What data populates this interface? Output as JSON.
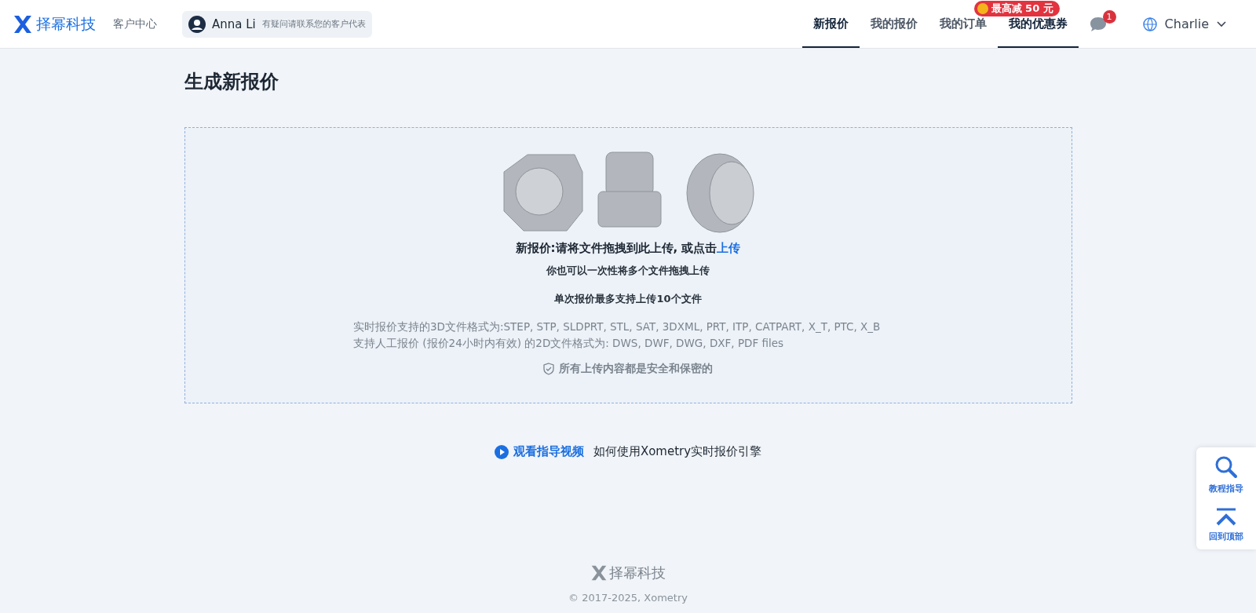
{
  "header": {
    "brand": "择幂科技",
    "section": "客户中心",
    "rep": {
      "name": "Anna Li",
      "hint": "有疑问请联系您的客户代表"
    },
    "nav": [
      {
        "label": "新报价",
        "selected": true
      },
      {
        "label": "我的报价",
        "selected": false
      },
      {
        "label": "我的订单",
        "selected": false
      },
      {
        "label": "我的优惠券",
        "selected": true,
        "badge": "最高减 50 元"
      }
    ],
    "messages_count": "1",
    "user": "Charlie"
  },
  "title": "生成新报价",
  "upload": {
    "headline": "新报价:请将文件拖拽到此上传, 或点击",
    "link": "上传",
    "multi": "你也可以一次性将多个文件拖拽上传",
    "limit": "单次报价最多支持上传10个文件",
    "formats_3d": "实时报价支持的3D文件格式为:STEP, STP, SLDPRT, STL, SAT, 3DXML, PRT, ITP, CATPART, X_T, PTC, X_B",
    "formats_2d": "支持人工报价 (报价24小时内有效) 的2D文件格式为: DWS, DWF, DWG, DXF, PDF files",
    "secure": "所有上传内容都是安全和保密的"
  },
  "guide": {
    "link": "观看指导视频",
    "text": "如何使用Xometry实时报价引擎"
  },
  "side": [
    {
      "kind": "search",
      "label": "教程指导"
    },
    {
      "kind": "top",
      "label": "回到顶部"
    }
  ],
  "footer": {
    "brand": "择幂科技",
    "copyright": "© 2017-2025, Xometry"
  }
}
